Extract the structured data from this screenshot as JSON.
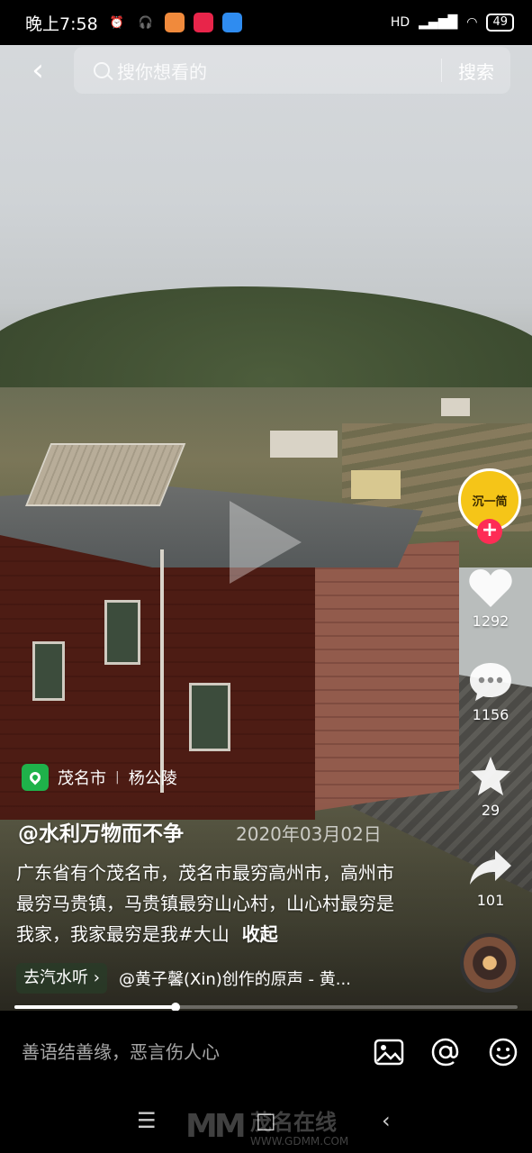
{
  "status_bar": {
    "time": "晚上7:58",
    "network": "HD",
    "battery": "49"
  },
  "search": {
    "placeholder": "搜你想看的",
    "button": "搜索"
  },
  "creator": {
    "avatar_text": "沉一简",
    "follow": "+"
  },
  "actions": {
    "likes": "1292",
    "comments": "1156",
    "favorites": "29",
    "shares": "101"
  },
  "location": {
    "city": "茂名市",
    "place": "杨公陵"
  },
  "post": {
    "author": "@水利万物而不争",
    "date": "2020年03月02日",
    "caption": "广东省有个茂名市，茂名市最穷高州市，高州市最穷马贵镇，马贵镇最穷山心村，山心村最穷是我家，我家最穷是我#大山",
    "collapse": "收起"
  },
  "music": {
    "tag": "去汽水听 ›",
    "title": "@黄子馨(Xin)创作的原声 - 黄..."
  },
  "progress": {
    "fraction": 0.32
  },
  "comment_bar": {
    "placeholder": "善语结善缘，恶言伤人心"
  },
  "watermark": {
    "logo": "MM",
    "name": "茂名在线",
    "url": "WWW.GDMM.COM"
  },
  "colors": {
    "follow": "#fe2c55",
    "location": "#1fb24a",
    "avatar": "#f5c518"
  }
}
